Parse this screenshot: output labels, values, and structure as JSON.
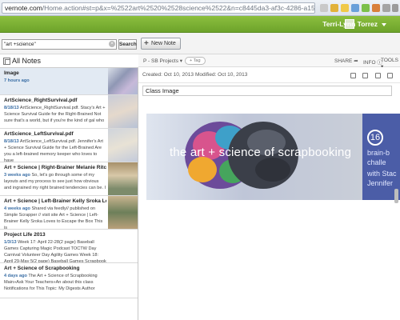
{
  "browser": {
    "url_domain": "vernote.com",
    "url_path": "/Home.action#st=p&x=%2522art%2520%2528science%2522&n=c8445da3-af3c-4286-a15b-372205422"
  },
  "header": {
    "user_name": "Terri-Lynn Torrez"
  },
  "search": {
    "value": "\"art +science\"",
    "button": "Search"
  },
  "toolbar": {
    "new_note": "New Note"
  },
  "list": {
    "heading": "All Notes",
    "notes": [
      {
        "title": "Image",
        "time": "7 hours ago",
        "snippet": ""
      },
      {
        "title": "ArtScience_RightSurvival.pdf",
        "time": "8/18/13",
        "snippet": "ArtScience_RightSurvival.pdf. Stacy's Art + Science Survival Guide for the Right-Brained Not sure that's a world, but if you're the kind of gal who"
      },
      {
        "title": "ArtScience_LeftSurvival.pdf",
        "time": "8/18/13",
        "snippet": "ArtScience_LeftSurvival.pdf. Jennifer's Art + Science Survival Guide for the Left-Brained Are you a left-brained memory keeper who loves to have"
      },
      {
        "title": "Art + Science | Right-Brainer Melanie Ritchie l",
        "time": "3 weeks ago",
        "snippet": "So, let's go through some of my layouts and my process to see just how obvious and ingrained my right brained tendencies can be. I"
      },
      {
        "title": "Art + Science | Left-Brainer Kelly Sroka Loves",
        "time": "4 weeks ago",
        "snippet": "Shared via feedly// published on Simple Scrapper // visit site Art + Science | Left-Brainer Kelly Sroka Loves to Escape the Box This is"
      },
      {
        "title": "Project Life 2013",
        "time": "1/3/13",
        "snippet": "Week 17: April 22-28(2 page) Baseball Games Capturing Magic Podcast TOCTW Day Carnival Volunteer Day Agility Games Week 18: April 29-May 5(2 page) Baseball Games Scrapbook"
      },
      {
        "title": "Art + Science of Scrapbooking",
        "time": "4 days ago",
        "snippet": "The Art + Science of Scrapbooking Main»Ask Your Teachers»An about this class Notifications for This Topic: My Digests Author"
      }
    ]
  },
  "note": {
    "notebook": "P - SB Projects",
    "tag": "+ Tag",
    "share": "SHARE",
    "info": "INFO",
    "tools": "TOOLS",
    "created": "Created: Oct 10, 2013",
    "modified": "Modified: Oct 10, 2013",
    "title": "Class Image",
    "banner_title": "the art + science of scrapbooking",
    "banner_number": "16",
    "banner_line1": "brain-b",
    "banner_line2": "challe",
    "banner_line3": "with Stac",
    "banner_line4": "Jennifer"
  },
  "colors": {
    "brand_green": "#7bb135",
    "link_blue": "#3a6ea5",
    "selected_row": "#e2eaf3"
  }
}
